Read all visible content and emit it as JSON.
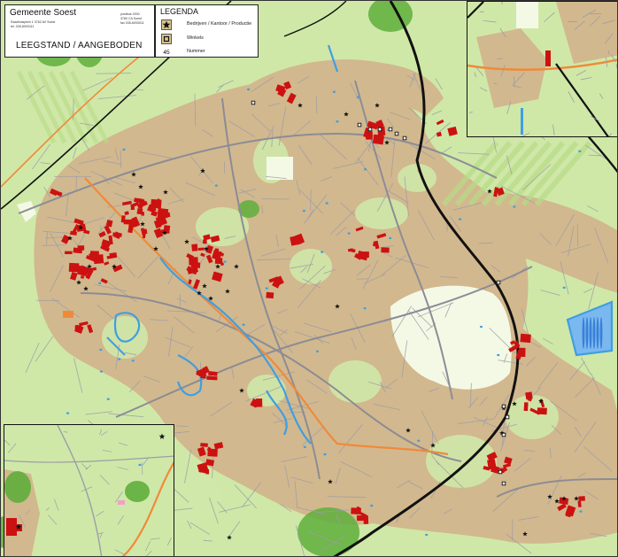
{
  "title_block": {
    "organisation": "Gemeente Soest",
    "address": {
      "line1_left": "Raadhuisplein 1   3762 AV Soest",
      "line2_left": "",
      "line1_right": "postbus 2000",
      "line2_right": "3760 CA Soest",
      "line3_right": "fax 035-6093011",
      "phone": "tel. 035-6093111"
    },
    "map_title": "LEEGSTAND / AANGEBODEN"
  },
  "legend": {
    "title": "LEGENDA",
    "items": [
      {
        "symbol": "star-icon",
        "label": "Bedrijven / Kantoor / Productie"
      },
      {
        "symbol": "shop-square-icon",
        "label": "Winkels"
      },
      {
        "symbol": "number-label",
        "symbol_text": "45",
        "label": "Nummer"
      }
    ]
  },
  "colors": {
    "greenland": "#cfe8a8",
    "built_area": "#d2b88e",
    "water": "#3f9fe0",
    "road": "#9d9da6",
    "railway": "#111111",
    "highway": "#f08a3a",
    "vacant_building": "#cc1111",
    "forest": "#5fae3c",
    "meadow": "#f4f9e6"
  },
  "insets": [
    {
      "name": "top-right-inset"
    },
    {
      "name": "bottom-left-inset"
    }
  ]
}
